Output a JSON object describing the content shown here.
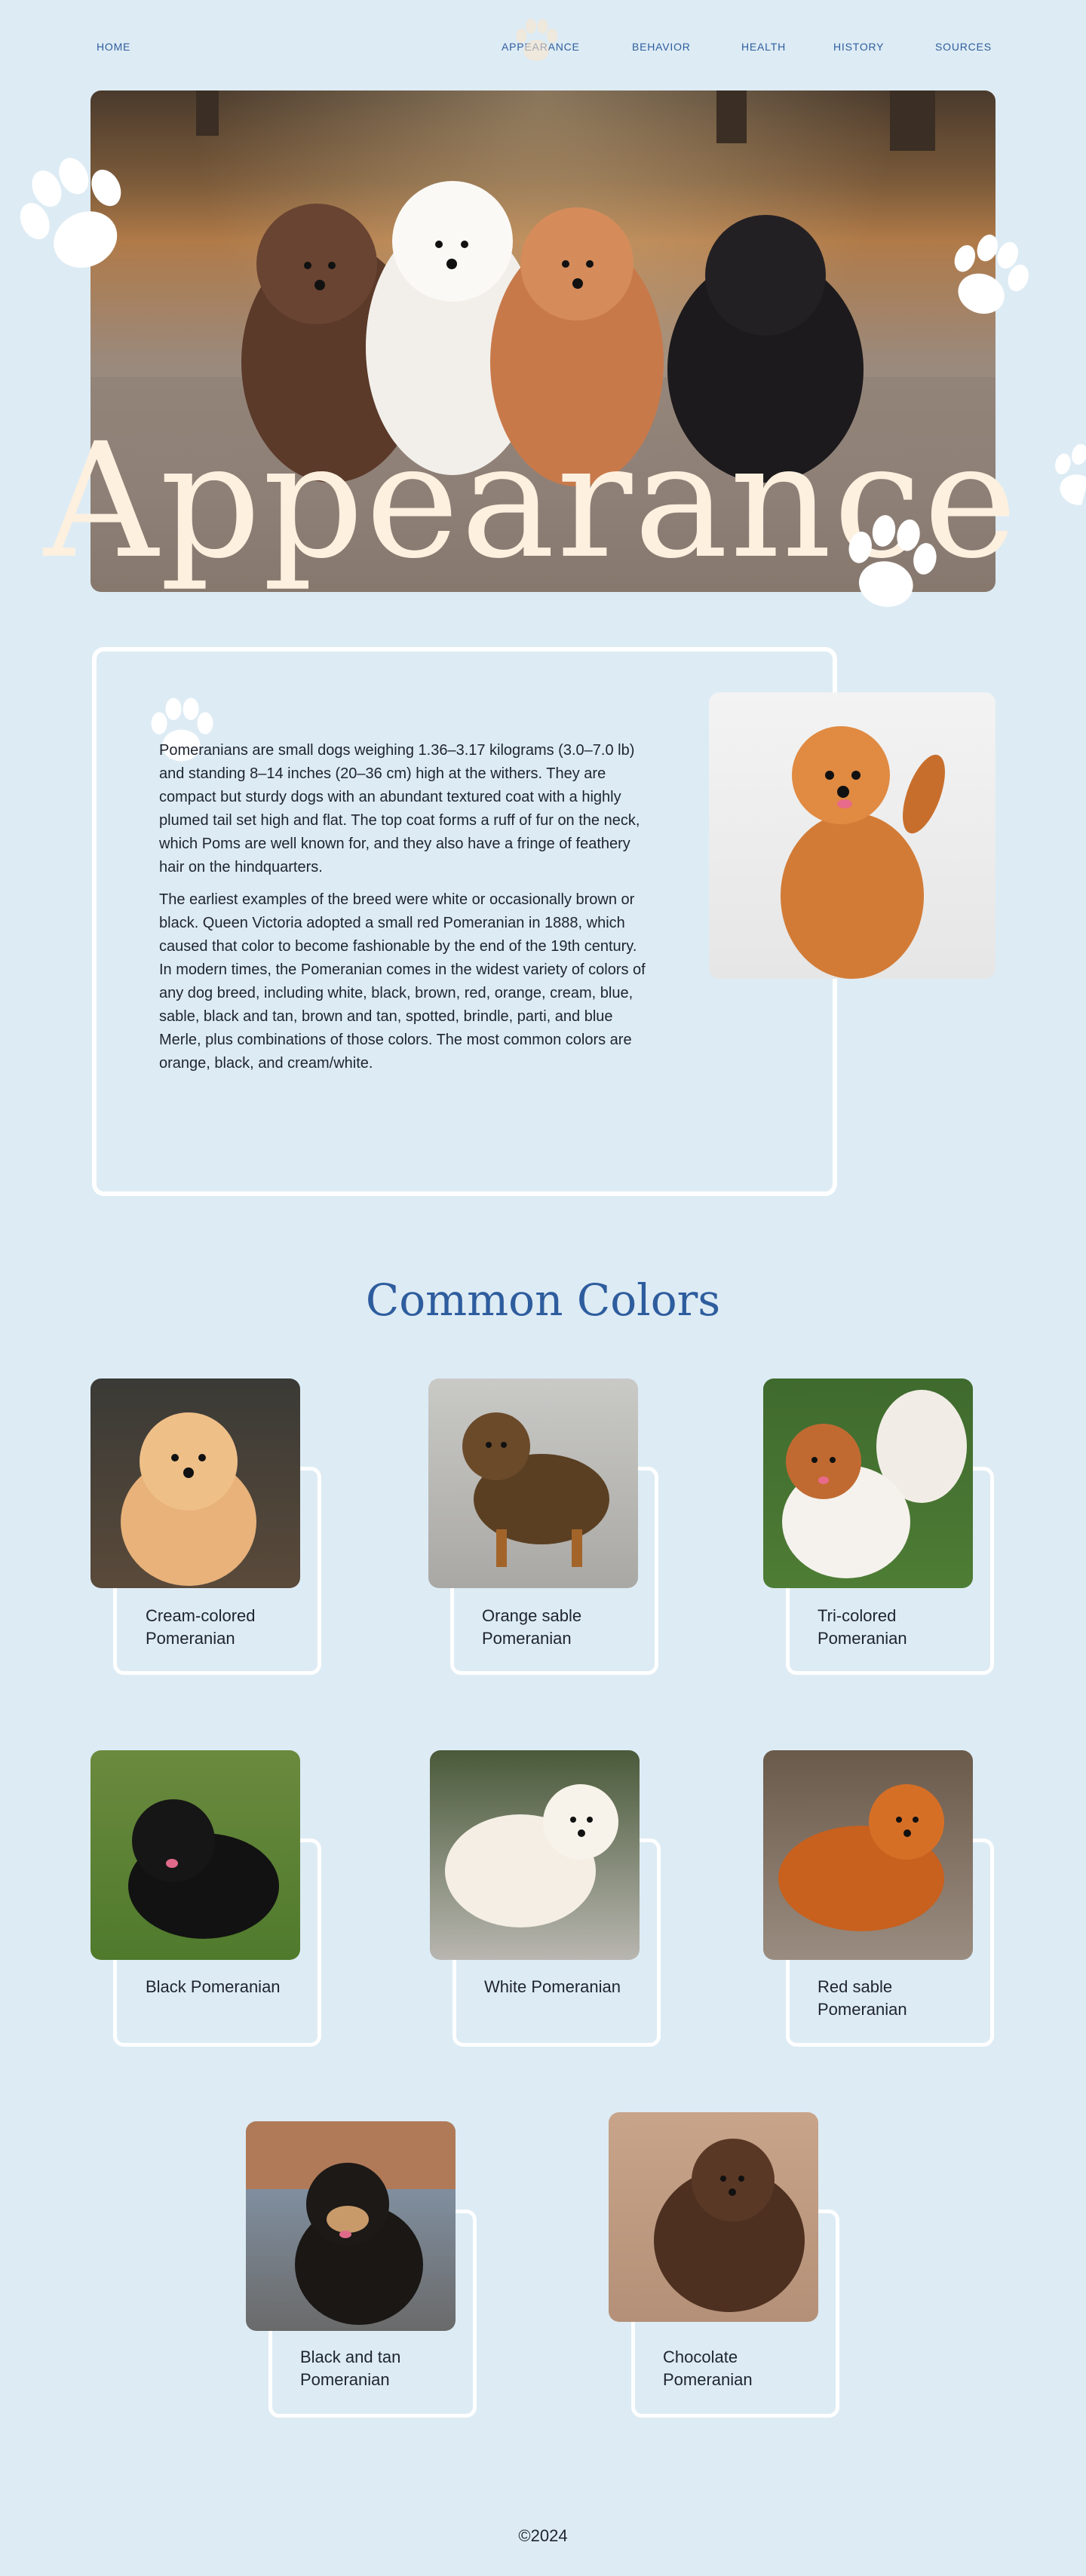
{
  "nav": {
    "home": "HOME",
    "appearance": "APPEARANCE",
    "behavior": "BEHAVIOR",
    "health": "HEALTH",
    "history": "HISTORY",
    "sources": "SOURCES"
  },
  "hero": {
    "title": "Appearance"
  },
  "about": {
    "p1": "Pomeranians are small dogs weighing 1.36–3.17 kilograms (3.0–7.0 lb) and standing 8–14 inches (20–36 cm) high at the withers. They are compact but sturdy dogs with an abundant textured coat with a highly plumed tail set high and flat. The top coat forms a ruff of fur on the neck, which Poms are well known for, and they also have a fringe of feathery hair on the hindquarters.",
    "p2": "The earliest examples of the breed were white or occasionally brown or black. Queen Victoria adopted a small red Pomeranian in 1888, which caused that color to become fashionable by the end of the 19th century. In modern times, the Pomeranian comes in the widest variety of colors of any dog breed, including white, black, brown, red, orange, cream, blue, sable, black and tan, brown and tan, spotted, brindle, parti, and blue Merle, plus combinations of those colors. The most common colors are orange, black, and cream/white."
  },
  "colors": {
    "title": "Common Colors",
    "items": [
      {
        "label": "Cream-colored Pomeranian"
      },
      {
        "label": "Orange sable Pomeranian"
      },
      {
        "label": "Tri-colored Pomeranian"
      },
      {
        "label": "Black Pomeranian"
      },
      {
        "label": "White Pomeranian"
      },
      {
        "label": "Red sable Pomeranian"
      },
      {
        "label": "Black and tan Pomeranian"
      },
      {
        "label": "Chocolate Pomeranian"
      }
    ]
  },
  "footer": {
    "text": "©2024"
  },
  "theme": {
    "background": "#ddebf4",
    "accent": "#2e5d9e",
    "title_color": "#fdf0df"
  }
}
